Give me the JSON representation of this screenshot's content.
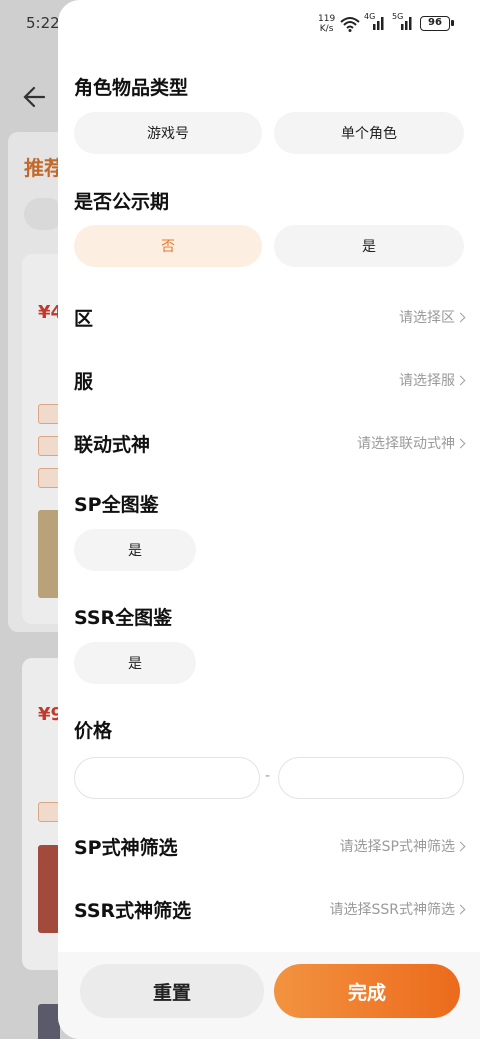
{
  "background": {
    "time": "5:22",
    "section_title": "推荐",
    "price_1": "¥4",
    "price_2": "¥9"
  },
  "status_bar": {
    "net_speed_value": "119",
    "net_speed_unit": "K/s",
    "signal_1": "4G",
    "signal_2": "5G",
    "battery": "96"
  },
  "filter": {
    "item_type": {
      "title": "角色物品类型",
      "options": [
        "游戏号",
        "单个角色"
      ]
    },
    "publicity": {
      "title": "是否公示期",
      "options": [
        "否",
        "是"
      ],
      "selected": "否"
    },
    "region": {
      "label": "区",
      "placeholder": "请选择区"
    },
    "server": {
      "label": "服",
      "placeholder": "请选择服"
    },
    "linked_shikigami": {
      "label": "联动式神",
      "placeholder": "请选择联动式神"
    },
    "sp_collection": {
      "title": "SP全图鉴",
      "option": "是"
    },
    "ssr_collection": {
      "title": "SSR全图鉴",
      "option": "是"
    },
    "price": {
      "title": "价格",
      "separator": "-",
      "min": "",
      "max": ""
    },
    "sp_filter": {
      "label": "SP式神筛选",
      "placeholder": "请选择SP式神筛选"
    },
    "ssr_filter": {
      "label": "SSR式神筛选",
      "placeholder": "请选择SSR式神筛选"
    }
  },
  "footer": {
    "reset": "重置",
    "done": "完成"
  },
  "colors": {
    "accent": "#ec6a1c",
    "accent_light": "#fdeee2"
  }
}
